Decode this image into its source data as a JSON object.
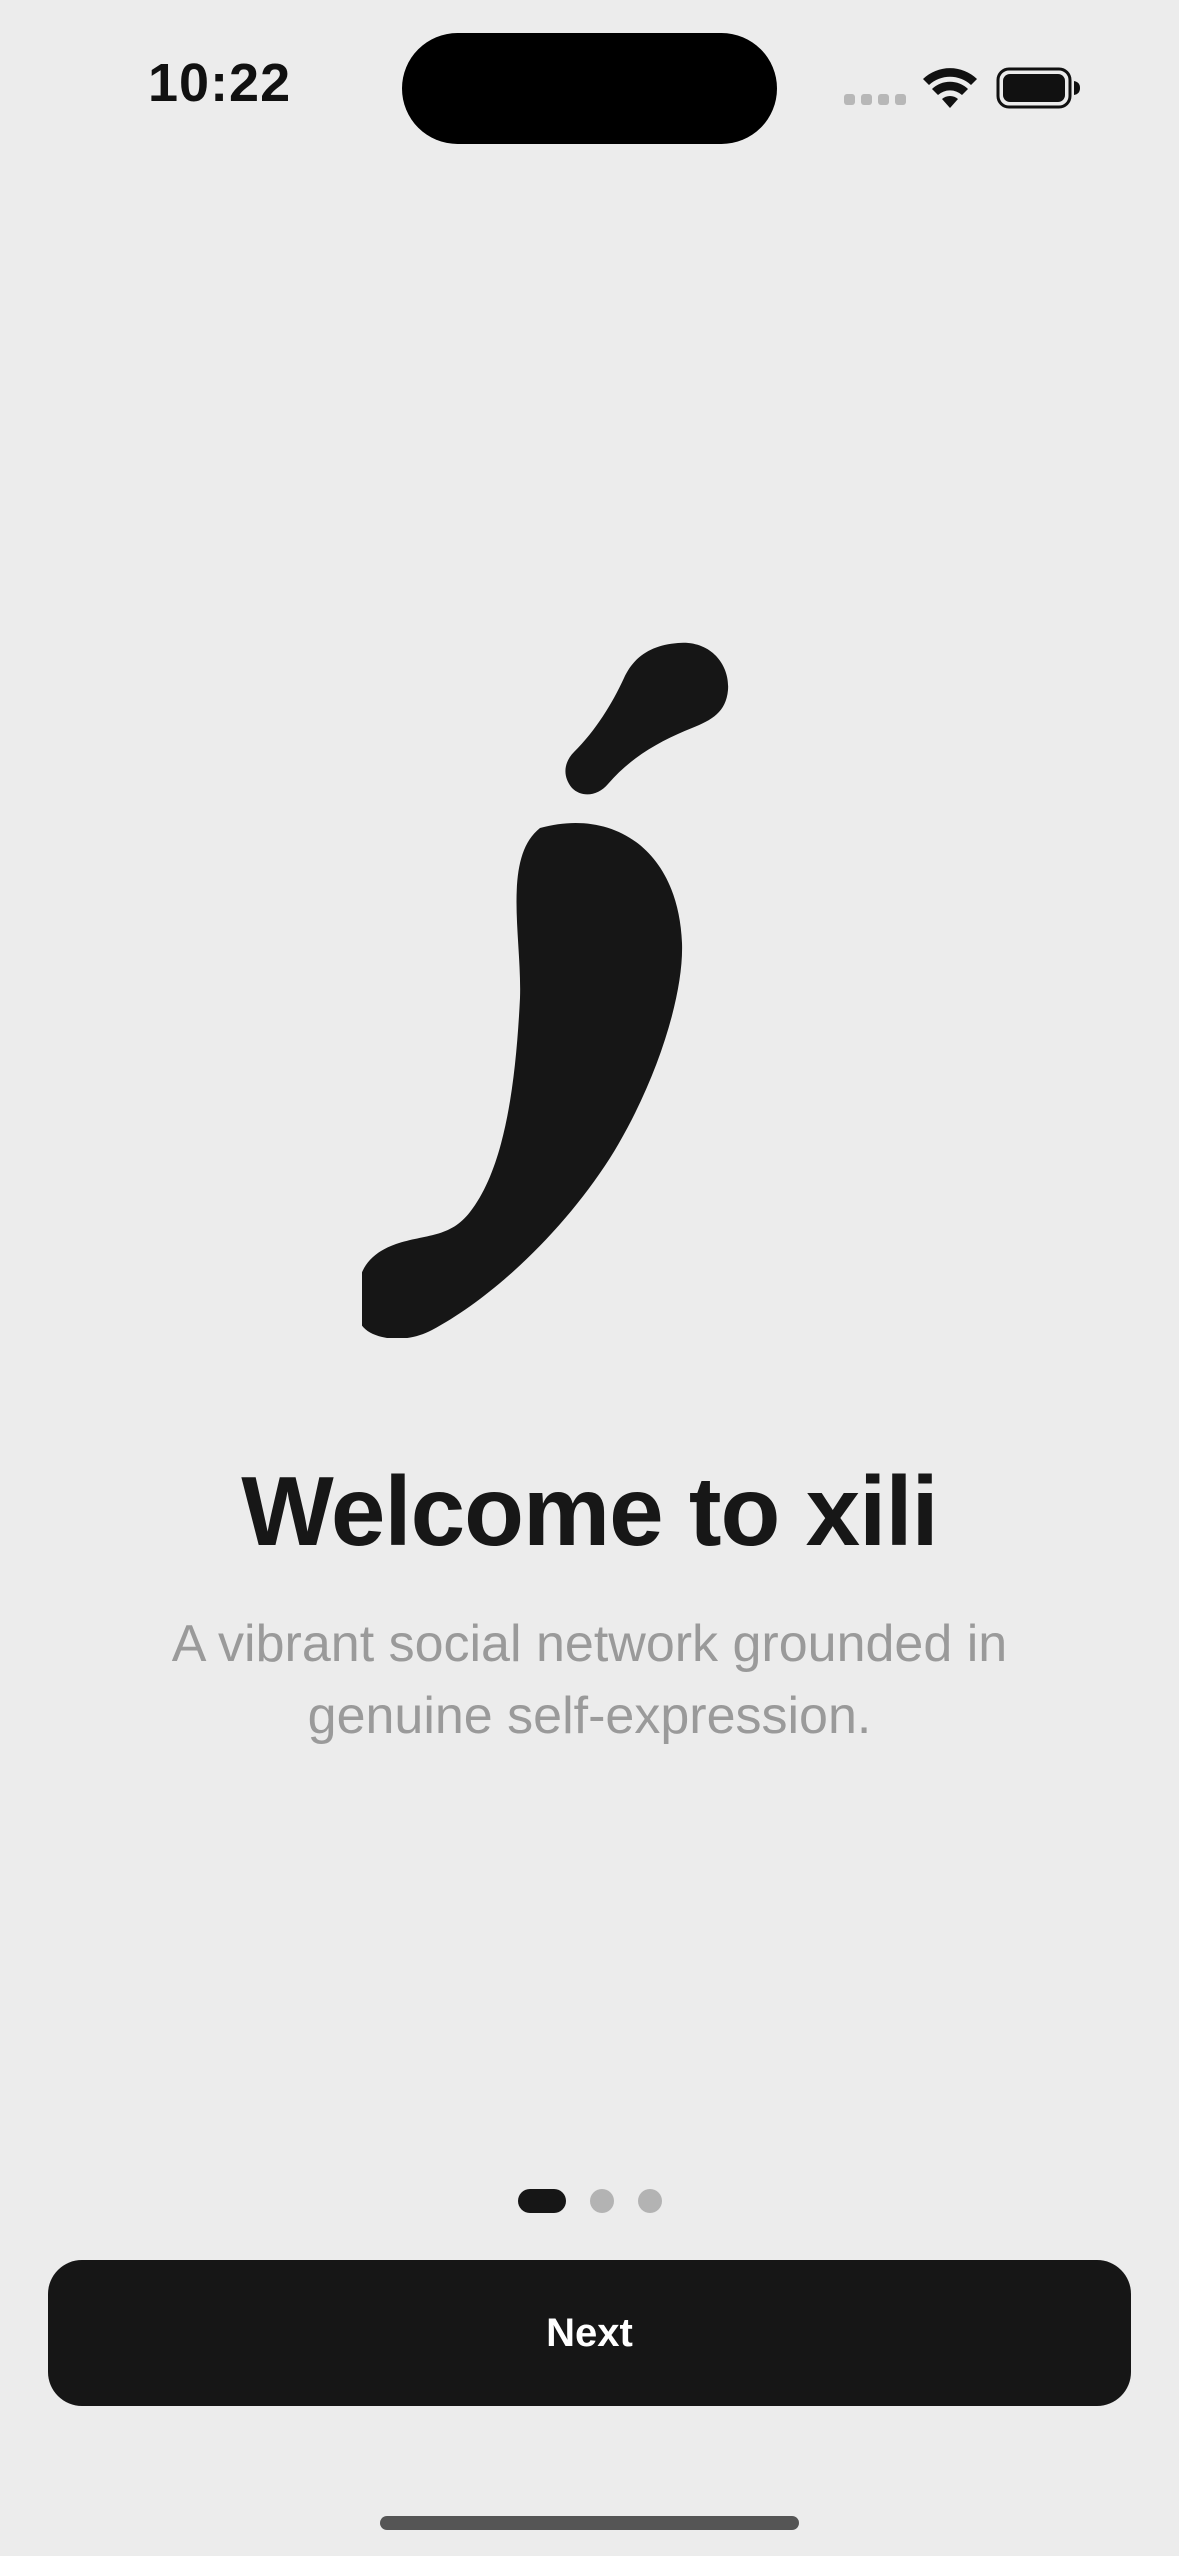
{
  "status_bar": {
    "time": "10:22",
    "signal_icon": "cellular-signal-dots-icon",
    "wifi_icon": "wifi-icon",
    "battery_icon": "battery-icon"
  },
  "onboarding": {
    "logo_icon": "chili-pepper-logo-icon",
    "title": "Welcome to xili",
    "subtitle": "A vibrant social network grounded in genuine self-expression.",
    "page_indicator": {
      "total_pages": 3,
      "current_page": 1
    },
    "next_label": "Next"
  },
  "colors": {
    "background": "#ececec",
    "primary": "#161616",
    "subtitle_text": "#9a9a9a",
    "inactive_dot": "#b3b3b3"
  }
}
